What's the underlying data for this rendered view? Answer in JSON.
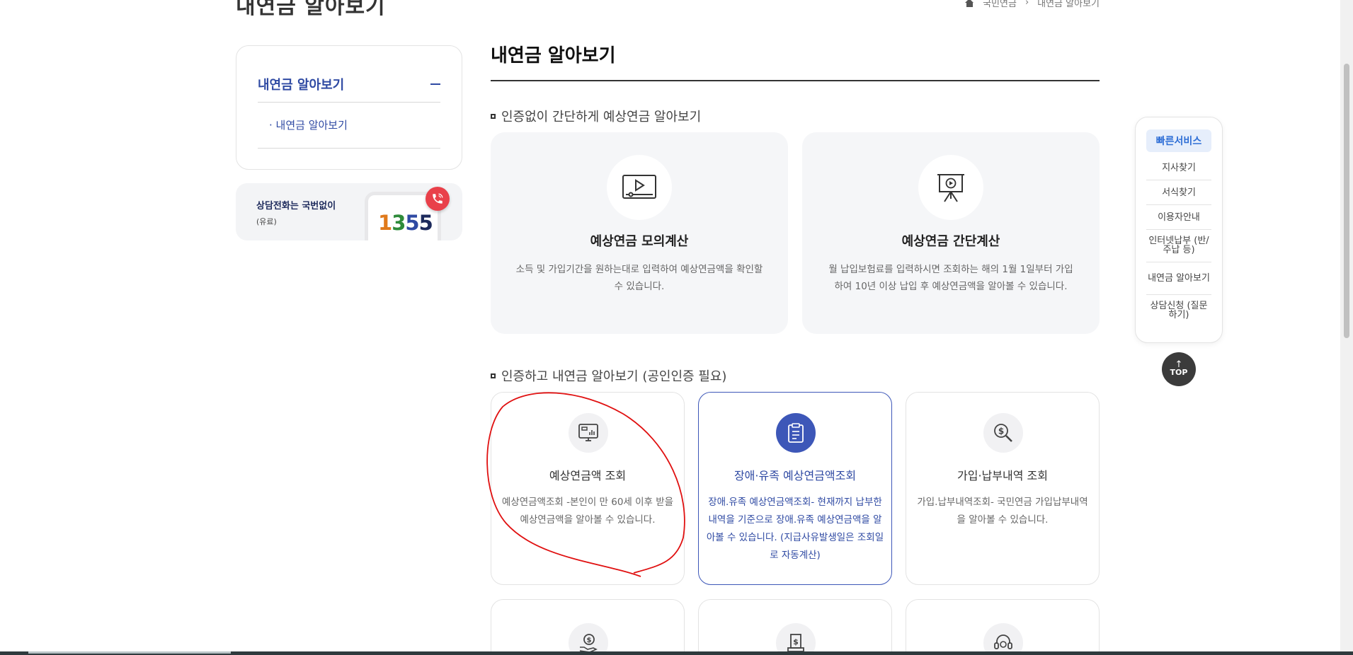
{
  "page": {
    "title": "내연금 알아보기",
    "breadcrumb": [
      "국민연금",
      "내연금 알아보기"
    ]
  },
  "sidebar": {
    "menu_title": "내연금 알아보기",
    "sub_item": "· 내연금 알아보기",
    "call": {
      "title": "상담전화는 국번없이",
      "note": "(유료)",
      "number": [
        "1",
        "3",
        "5",
        "5"
      ]
    }
  },
  "main": {
    "title": "내연금 알아보기",
    "section1": {
      "title": "인증없이 간단하게 예상연금 알아보기",
      "cards": [
        {
          "title": "예상연금 모의계산",
          "desc": "소득 및 가입기간을 원하는대로 입력하여 예상연금액을 확인할 수 있습니다.",
          "icon": "video-screen-icon"
        },
        {
          "title": "예상연금 간단계산",
          "desc": "월 납입보험료를 입력하시면 조회하는 해의 1월 1일부터 가입하여 10년 이상 납입 후 예상연금액을 알아볼 수 있습니다.",
          "icon": "presentation-board-icon"
        }
      ]
    },
    "section2": {
      "title": "인증하고 내연금 알아보기 (공인인증 필요)",
      "cards": [
        {
          "title": "예상연금액 조회",
          "desc": "예상연금액조회 -본인이 만 60세 이후 받을 예상연금액을 알아볼 수 있습니다.",
          "icon": "monitor-chart-icon"
        },
        {
          "title": "장애·유족 예상연금액조회",
          "desc": "장애.유족 예상연금액조회- 현재까지 납부한 내역을 기준으로 장애.유족 예상연금액을 알아볼 수 있습니다. (지급사유발생일은 조회일로 자동계산)",
          "icon": "clipboard-icon"
        },
        {
          "title": "가입·납부내역 조회",
          "desc": "가입.납부내역조회- 국민연금 가입납부내역을 알아볼 수 있습니다.",
          "icon": "dollar-search-icon"
        }
      ],
      "more_icons": [
        "hand-coin-icon",
        "dollar-document-icon",
        "headset-icon"
      ]
    }
  },
  "quick_menu": {
    "title": "빠른서비스",
    "items": [
      "지사찾기",
      "서식찾기",
      "이용자안내",
      "인터넷납부 (반/주납 등)",
      "내연금 알아보기",
      "상담신청 (질문하기)"
    ],
    "top": "TOP"
  },
  "colors": {
    "accent": "#2f4aa3",
    "quick_accent": "#2f6fd6",
    "annotation": "#e01010"
  }
}
